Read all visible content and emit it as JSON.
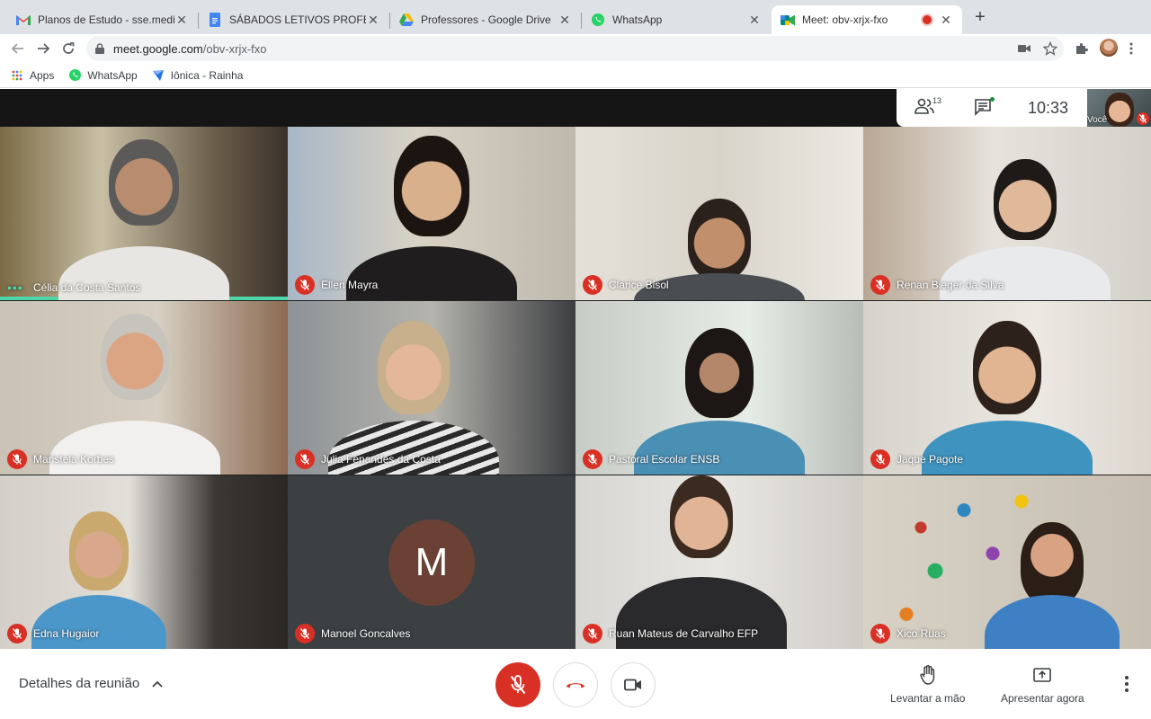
{
  "tabs": [
    {
      "title": "Planos de Estudo - sse.medio@",
      "icon": "gmail-icon"
    },
    {
      "title": "SÁBADOS LETIVOS PROFESSO",
      "icon": "docs-icon"
    },
    {
      "title": "Professores - Google Drive",
      "icon": "drive-icon"
    },
    {
      "title": "WhatsApp",
      "icon": "whatsapp-icon"
    },
    {
      "title": "Meet: obv-xrjx-fxo",
      "icon": "meet-icon",
      "recording": true
    }
  ],
  "omnibox": {
    "host": "meet.google.com",
    "path": "/obv-xrjx-fxo"
  },
  "bookmarks": [
    {
      "label": "Apps",
      "icon": "apps-grid-icon"
    },
    {
      "label": "WhatsApp",
      "icon": "whatsapp-icon"
    },
    {
      "label": "Iônica - Rainha",
      "icon": "bookmark-arrow-icon"
    }
  ],
  "meet": {
    "people_count": "13",
    "time": "10:33",
    "self_label": "Você",
    "participants": [
      {
        "name": "Célia da Costa Santos",
        "speaking": true
      },
      {
        "name": "Ellen Mayra"
      },
      {
        "name": "Clarice Bisol"
      },
      {
        "name": "Renan Bieger da Silva"
      },
      {
        "name": "Maristela Korbes"
      },
      {
        "name": "Julia Fenandes da Costa"
      },
      {
        "name": "Pastoral Escolar ENSB"
      },
      {
        "name": "Jaque Pagote"
      },
      {
        "name": "Edna Hugaior"
      },
      {
        "name": "Manoel Goncalves",
        "avatar_letter": "M"
      },
      {
        "name": "Ruan Mateus de Carvalho EFP"
      },
      {
        "name": "Xico Ruas"
      }
    ]
  },
  "bottom": {
    "details_label": "Detalhes da reunião",
    "raise_hand_label": "Levantar a mão",
    "present_label": "Apresentar agora"
  },
  "colors": {
    "danger": "#d93025",
    "speaking": "#4ed5a8",
    "avatar": "#6b4135"
  }
}
